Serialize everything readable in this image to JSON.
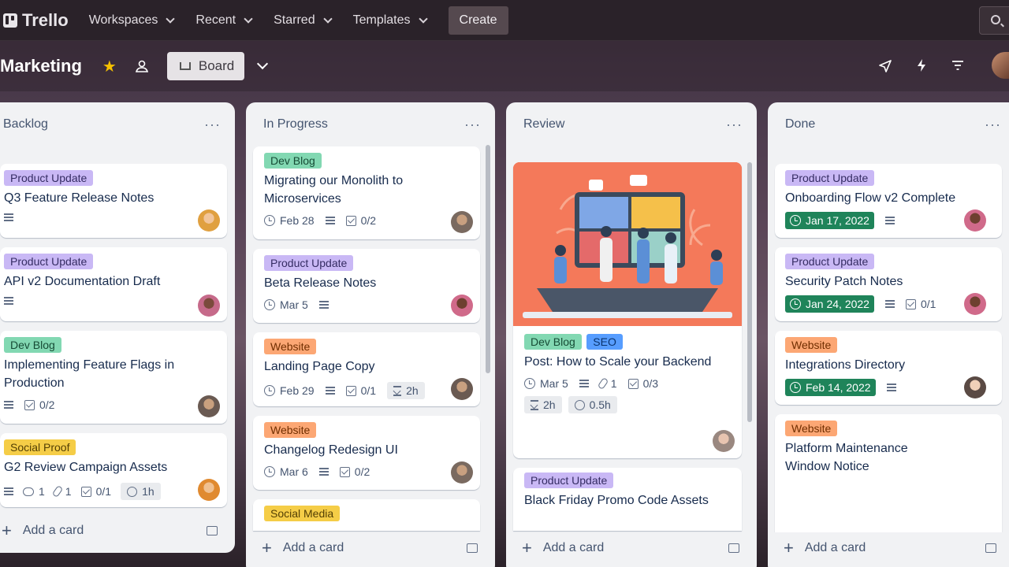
{
  "topbar": {
    "logo": "Trello",
    "nav": [
      "Workspaces",
      "Recent",
      "Starred",
      "Templates"
    ],
    "create": "Create"
  },
  "board": {
    "title": "Marketing",
    "view": "Board"
  },
  "lists": [
    {
      "title": "Backlog",
      "add": "Add a card",
      "cards": [
        {
          "label": "Product Update",
          "title": "Q3 Feature Release Notes"
        },
        {
          "label": "Product Update",
          "title": "API v2 Documentation Draft"
        },
        {
          "label": "Dev Blog",
          "title": "Implementing Feature Flags in Production",
          "checklist": "0/2"
        },
        {
          "label": "Social Proof",
          "title": "G2 Review Campaign Assets",
          "comments": "1",
          "attachments": "1",
          "checklist": "0/1",
          "time": "1h"
        }
      ]
    },
    {
      "title": "In Progress",
      "add": "Add a card",
      "cards": [
        {
          "label": "Dev Blog",
          "title": "Migrating our Monolith to Microservices",
          "date": "Feb 28",
          "checklist": "0/2"
        },
        {
          "label": "Product Update",
          "title": "Beta Release Notes",
          "date": "Mar 5"
        },
        {
          "label": "Website",
          "title": "Landing Page Copy",
          "date": "Feb 29",
          "checklist": "0/1",
          "estimate": "2h"
        },
        {
          "label": "Website",
          "title": "Changelog Redesign UI",
          "date": "Mar 6",
          "checklist": "0/2"
        },
        {
          "label": "Social Media"
        }
      ]
    },
    {
      "title": "Review",
      "add": "Add a card",
      "cards": [
        {
          "labels": [
            "Dev Blog",
            "SEO"
          ],
          "title": "Post: How to Scale your Backend",
          "date": "Mar 5",
          "attachments": "1",
          "checklist": "0/3",
          "estimate": "2h",
          "time": "0.5h"
        },
        {
          "label": "Product Update",
          "title": "Black Friday Promo Code Assets"
        }
      ]
    },
    {
      "title": "Done",
      "add": "Add a card",
      "cards": [
        {
          "label": "Product Update",
          "title": "Onboarding Flow v2 Complete",
          "date": "Jan 17, 2022"
        },
        {
          "label": "Product Update",
          "title": "Security Patch Notes",
          "date": "Jan 24, 2022",
          "checklist": "0/1"
        },
        {
          "label": "Website",
          "title": "Integrations Directory",
          "date": "Feb 14, 2022"
        },
        {
          "label": "Website",
          "title": "Platform Maintenance Window Notice"
        }
      ]
    }
  ],
  "colors": {
    "purple_label": "#c9b8f5",
    "green_label": "#82d8b2",
    "orange_label": "#fca774",
    "yellow_label": "#f5cd47",
    "blue_label": "#579dff",
    "due_complete": "#1f845a",
    "star": "#f5c000"
  },
  "icons": [
    "search-icon",
    "star-icon",
    "workspace-visibility-icon",
    "board-view-icon",
    "chevron-down-icon",
    "power-ups-icon",
    "automation-icon",
    "filter-icon",
    "more-icon",
    "plus-icon",
    "card-template-icon"
  ]
}
